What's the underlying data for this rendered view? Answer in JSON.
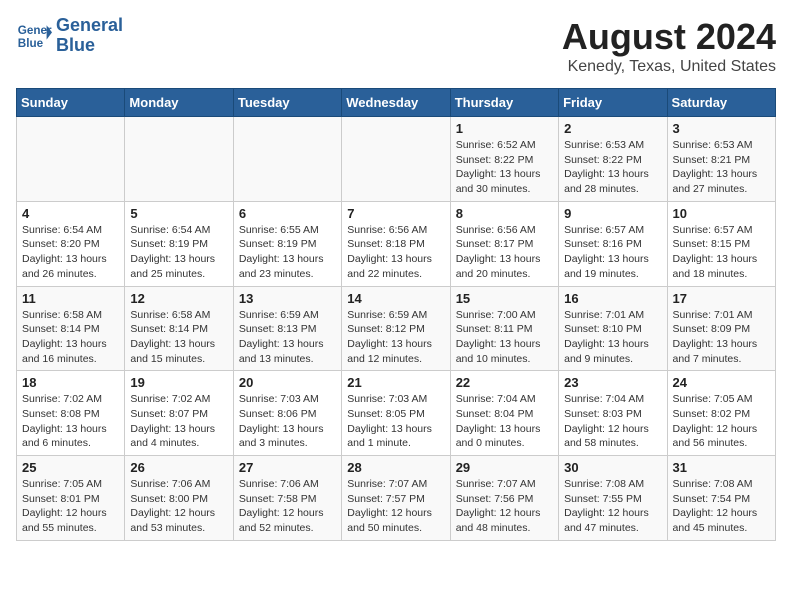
{
  "header": {
    "logo_line1": "General",
    "logo_line2": "Blue",
    "title": "August 2024",
    "subtitle": "Kenedy, Texas, United States"
  },
  "days_of_week": [
    "Sunday",
    "Monday",
    "Tuesday",
    "Wednesday",
    "Thursday",
    "Friday",
    "Saturday"
  ],
  "weeks": [
    [
      {
        "day": "",
        "info": ""
      },
      {
        "day": "",
        "info": ""
      },
      {
        "day": "",
        "info": ""
      },
      {
        "day": "",
        "info": ""
      },
      {
        "day": "1",
        "info": "Sunrise: 6:52 AM\nSunset: 8:22 PM\nDaylight: 13 hours\nand 30 minutes."
      },
      {
        "day": "2",
        "info": "Sunrise: 6:53 AM\nSunset: 8:22 PM\nDaylight: 13 hours\nand 28 minutes."
      },
      {
        "day": "3",
        "info": "Sunrise: 6:53 AM\nSunset: 8:21 PM\nDaylight: 13 hours\nand 27 minutes."
      }
    ],
    [
      {
        "day": "4",
        "info": "Sunrise: 6:54 AM\nSunset: 8:20 PM\nDaylight: 13 hours\nand 26 minutes."
      },
      {
        "day": "5",
        "info": "Sunrise: 6:54 AM\nSunset: 8:19 PM\nDaylight: 13 hours\nand 25 minutes."
      },
      {
        "day": "6",
        "info": "Sunrise: 6:55 AM\nSunset: 8:19 PM\nDaylight: 13 hours\nand 23 minutes."
      },
      {
        "day": "7",
        "info": "Sunrise: 6:56 AM\nSunset: 8:18 PM\nDaylight: 13 hours\nand 22 minutes."
      },
      {
        "day": "8",
        "info": "Sunrise: 6:56 AM\nSunset: 8:17 PM\nDaylight: 13 hours\nand 20 minutes."
      },
      {
        "day": "9",
        "info": "Sunrise: 6:57 AM\nSunset: 8:16 PM\nDaylight: 13 hours\nand 19 minutes."
      },
      {
        "day": "10",
        "info": "Sunrise: 6:57 AM\nSunset: 8:15 PM\nDaylight: 13 hours\nand 18 minutes."
      }
    ],
    [
      {
        "day": "11",
        "info": "Sunrise: 6:58 AM\nSunset: 8:14 PM\nDaylight: 13 hours\nand 16 minutes."
      },
      {
        "day": "12",
        "info": "Sunrise: 6:58 AM\nSunset: 8:14 PM\nDaylight: 13 hours\nand 15 minutes."
      },
      {
        "day": "13",
        "info": "Sunrise: 6:59 AM\nSunset: 8:13 PM\nDaylight: 13 hours\nand 13 minutes."
      },
      {
        "day": "14",
        "info": "Sunrise: 6:59 AM\nSunset: 8:12 PM\nDaylight: 13 hours\nand 12 minutes."
      },
      {
        "day": "15",
        "info": "Sunrise: 7:00 AM\nSunset: 8:11 PM\nDaylight: 13 hours\nand 10 minutes."
      },
      {
        "day": "16",
        "info": "Sunrise: 7:01 AM\nSunset: 8:10 PM\nDaylight: 13 hours\nand 9 minutes."
      },
      {
        "day": "17",
        "info": "Sunrise: 7:01 AM\nSunset: 8:09 PM\nDaylight: 13 hours\nand 7 minutes."
      }
    ],
    [
      {
        "day": "18",
        "info": "Sunrise: 7:02 AM\nSunset: 8:08 PM\nDaylight: 13 hours\nand 6 minutes."
      },
      {
        "day": "19",
        "info": "Sunrise: 7:02 AM\nSunset: 8:07 PM\nDaylight: 13 hours\nand 4 minutes."
      },
      {
        "day": "20",
        "info": "Sunrise: 7:03 AM\nSunset: 8:06 PM\nDaylight: 13 hours\nand 3 minutes."
      },
      {
        "day": "21",
        "info": "Sunrise: 7:03 AM\nSunset: 8:05 PM\nDaylight: 13 hours\nand 1 minute."
      },
      {
        "day": "22",
        "info": "Sunrise: 7:04 AM\nSunset: 8:04 PM\nDaylight: 13 hours\nand 0 minutes."
      },
      {
        "day": "23",
        "info": "Sunrise: 7:04 AM\nSunset: 8:03 PM\nDaylight: 12 hours\nand 58 minutes."
      },
      {
        "day": "24",
        "info": "Sunrise: 7:05 AM\nSunset: 8:02 PM\nDaylight: 12 hours\nand 56 minutes."
      }
    ],
    [
      {
        "day": "25",
        "info": "Sunrise: 7:05 AM\nSunset: 8:01 PM\nDaylight: 12 hours\nand 55 minutes."
      },
      {
        "day": "26",
        "info": "Sunrise: 7:06 AM\nSunset: 8:00 PM\nDaylight: 12 hours\nand 53 minutes."
      },
      {
        "day": "27",
        "info": "Sunrise: 7:06 AM\nSunset: 7:58 PM\nDaylight: 12 hours\nand 52 minutes."
      },
      {
        "day": "28",
        "info": "Sunrise: 7:07 AM\nSunset: 7:57 PM\nDaylight: 12 hours\nand 50 minutes."
      },
      {
        "day": "29",
        "info": "Sunrise: 7:07 AM\nSunset: 7:56 PM\nDaylight: 12 hours\nand 48 minutes."
      },
      {
        "day": "30",
        "info": "Sunrise: 7:08 AM\nSunset: 7:55 PM\nDaylight: 12 hours\nand 47 minutes."
      },
      {
        "day": "31",
        "info": "Sunrise: 7:08 AM\nSunset: 7:54 PM\nDaylight: 12 hours\nand 45 minutes."
      }
    ]
  ]
}
